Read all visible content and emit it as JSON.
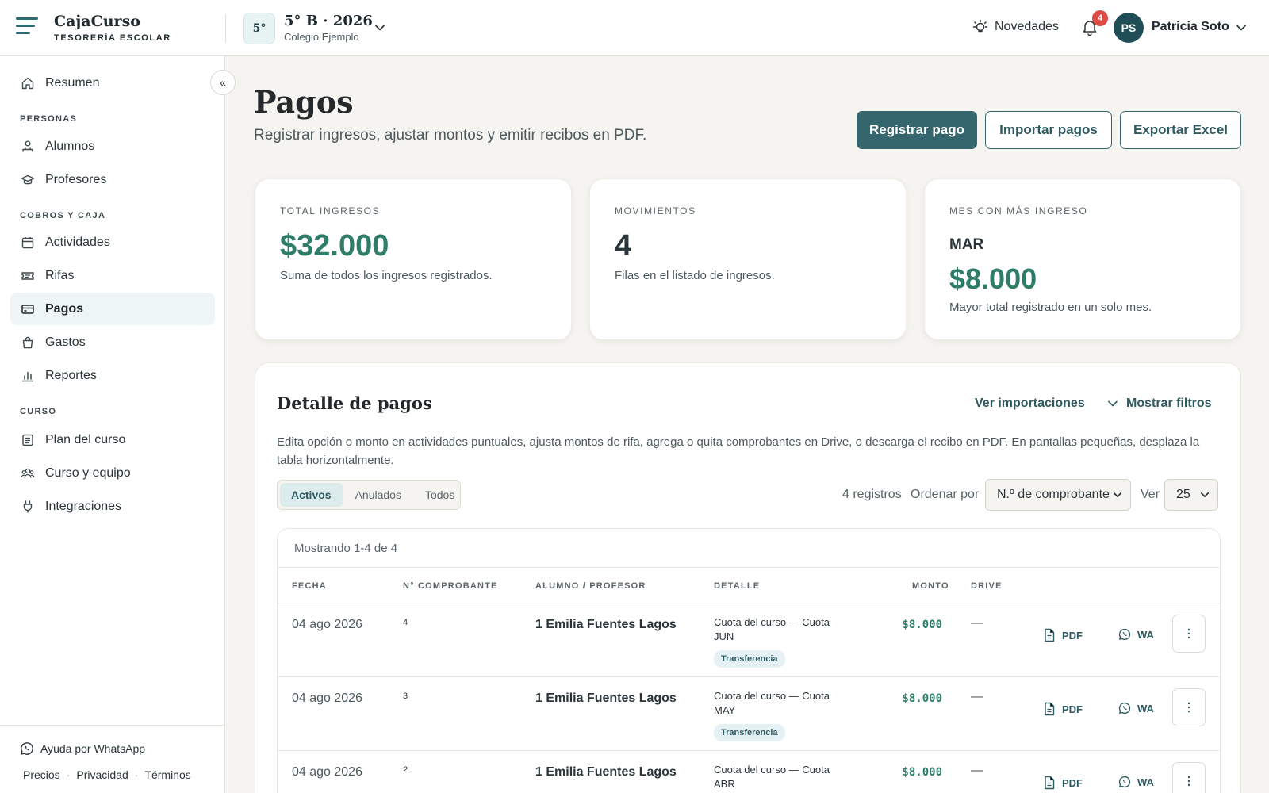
{
  "brand": {
    "name": "CajaCurso",
    "subtitle": "TESORERÍA ESCOLAR"
  },
  "course": {
    "badge": "5°",
    "title": "5° B · 2026",
    "school": "Colegio Ejemplo"
  },
  "topbar": {
    "news_label": "Novedades",
    "notifications_count": "4",
    "user_initials": "PS",
    "user_name": "Patricia Soto"
  },
  "sidebar": {
    "collapse_glyph": "«",
    "summary": "Resumen",
    "sections": {
      "people": "PERSONAS",
      "billing": "COBROS Y CAJA",
      "course": "CURSO"
    },
    "items": {
      "students": "Alumnos",
      "teachers": "Profesores",
      "activities": "Actividades",
      "raffles": "Rifas",
      "payments": "Pagos",
      "expenses": "Gastos",
      "reports": "Reportes",
      "plan": "Plan del curso",
      "team": "Curso y equipo",
      "integrations": "Integraciones"
    },
    "help": "Ayuda por WhatsApp",
    "footer": {
      "prices": "Precios",
      "privacy": "Privacidad",
      "terms": "Términos",
      "separator": "·"
    }
  },
  "page": {
    "title": "Pagos",
    "subtitle": "Registrar ingresos, ajustar montos y emitir recibos en PDF.",
    "buttons": {
      "register": "Registrar pago",
      "import": "Importar pagos",
      "export": "Exportar Excel"
    }
  },
  "stats": {
    "total": {
      "label": "TOTAL INGRESOS",
      "value": "$32.000",
      "desc": "Suma de todos los ingresos registrados."
    },
    "movements": {
      "label": "MOVIMIENTOS",
      "value": "4",
      "desc": "Filas en el listado de ingresos."
    },
    "top_month": {
      "label": "MES CON MÁS INGRESO",
      "month": "MAR",
      "value": "$8.000",
      "desc": "Mayor total registrado en un solo mes."
    }
  },
  "detail": {
    "title": "Detalle de pagos",
    "link_imports": "Ver importaciones",
    "link_filters": "Mostrar filtros",
    "description": "Edita opción o monto en actividades puntuales, ajusta montos de rifa, agrega o quita comprobantes en Drive, o descarga el recibo en PDF. En pantallas pequeñas, desplaza la tabla horizontalmente.",
    "tabs": [
      "Activos",
      "Anulados",
      "Todos"
    ],
    "records": "4 registros",
    "order_label": "Ordenar por",
    "order_value": "N.º de comprobante",
    "view_label": "Ver",
    "view_value": "25",
    "showing": "Mostrando 1-4 de 4",
    "columns": [
      "FECHA",
      "N° COMPROBANTE",
      "ALUMNO / PROFESOR",
      "DETALLE",
      "MONTO",
      "DRIVE"
    ],
    "actions": {
      "pdf": "PDF",
      "wa": "WA"
    },
    "rows": [
      {
        "date": "04 ago 2026",
        "number": "4",
        "person": "1 Emilia Fuentes Lagos",
        "detail": "Cuota del curso — Cuota JUN",
        "method": "Transferencia",
        "amount": "$8.000",
        "drive": "—"
      },
      {
        "date": "04 ago 2026",
        "number": "3",
        "person": "1 Emilia Fuentes Lagos",
        "detail": "Cuota del curso — Cuota MAY",
        "method": "Transferencia",
        "amount": "$8.000",
        "drive": "—"
      },
      {
        "date": "04 ago 2026",
        "number": "2",
        "person": "1 Emilia Fuentes Lagos",
        "detail": "Cuota del curso — Cuota ABR",
        "method": "",
        "amount": "$8.000",
        "drive": "—"
      }
    ]
  },
  "colors": {
    "accent": "#36666d",
    "money": "#2e7d68",
    "badge": "#e04a44"
  }
}
